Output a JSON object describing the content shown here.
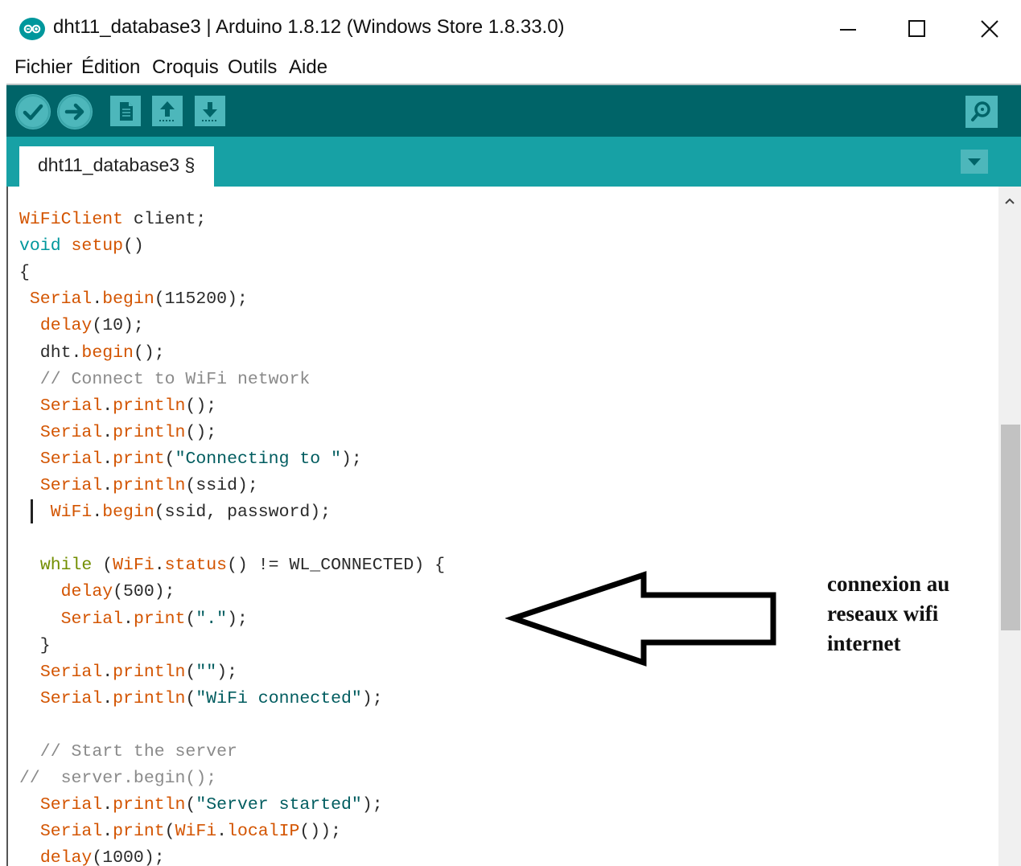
{
  "window": {
    "title": "dht11_database3 | Arduino 1.8.12 (Windows Store 1.8.33.0)",
    "icon": "arduino-infinity-icon",
    "controls": [
      "minimize-icon",
      "maximize-icon",
      "close-icon"
    ]
  },
  "menu": {
    "items": [
      "Fichier",
      "Édition",
      "Croquis",
      "Outils",
      "Aide"
    ]
  },
  "toolbar": {
    "buttons": [
      "verify-icon",
      "upload-icon",
      "new-icon",
      "open-icon",
      "save-icon"
    ],
    "serial_monitor": "serial-monitor-icon",
    "colors": {
      "bar": "#006468",
      "button": "#4db7bb",
      "tabbar": "#17a1a5"
    }
  },
  "tabs": {
    "active": "dht11_database3 §",
    "menu_icon": "tab-dropdown-icon"
  },
  "code": {
    "lines": [
      [
        {
          "t": "WiFiClient",
          "c": "cls"
        },
        {
          "t": " client;",
          "c": "n"
        }
      ],
      [
        {
          "t": "void",
          "c": "type"
        },
        {
          "t": " ",
          "c": "n"
        },
        {
          "t": "setup",
          "c": "fn"
        },
        {
          "t": "()",
          "c": "n"
        }
      ],
      [
        {
          "t": "{",
          "c": "n"
        }
      ],
      [
        {
          "t": " ",
          "c": "n"
        },
        {
          "t": "Serial",
          "c": "cls"
        },
        {
          "t": ".",
          "c": "n"
        },
        {
          "t": "begin",
          "c": "fn"
        },
        {
          "t": "(115200);",
          "c": "n"
        }
      ],
      [
        {
          "t": "  ",
          "c": "n"
        },
        {
          "t": "delay",
          "c": "fn"
        },
        {
          "t": "(10);",
          "c": "n"
        }
      ],
      [
        {
          "t": "  dht.",
          "c": "n"
        },
        {
          "t": "begin",
          "c": "fn"
        },
        {
          "t": "();",
          "c": "n"
        }
      ],
      [
        {
          "t": "  // Connect to WiFi network",
          "c": "cmt"
        }
      ],
      [
        {
          "t": "  ",
          "c": "n"
        },
        {
          "t": "Serial",
          "c": "cls"
        },
        {
          "t": ".",
          "c": "n"
        },
        {
          "t": "println",
          "c": "fn"
        },
        {
          "t": "();",
          "c": "n"
        }
      ],
      [
        {
          "t": "  ",
          "c": "n"
        },
        {
          "t": "Serial",
          "c": "cls"
        },
        {
          "t": ".",
          "c": "n"
        },
        {
          "t": "println",
          "c": "fn"
        },
        {
          "t": "();",
          "c": "n"
        }
      ],
      [
        {
          "t": "  ",
          "c": "n"
        },
        {
          "t": "Serial",
          "c": "cls"
        },
        {
          "t": ".",
          "c": "n"
        },
        {
          "t": "print",
          "c": "fn"
        },
        {
          "t": "(",
          "c": "n"
        },
        {
          "t": "\"Connecting to \"",
          "c": "str"
        },
        {
          "t": ");",
          "c": "n"
        }
      ],
      [
        {
          "t": "  ",
          "c": "n"
        },
        {
          "t": "Serial",
          "c": "cls"
        },
        {
          "t": ".",
          "c": "n"
        },
        {
          "t": "println",
          "c": "fn"
        },
        {
          "t": "(ssid);",
          "c": "n"
        }
      ],
      [
        {
          "t": "   ",
          "c": "n"
        },
        {
          "t": "WiFi",
          "c": "cls"
        },
        {
          "t": ".",
          "c": "n"
        },
        {
          "t": "begin",
          "c": "fn"
        },
        {
          "t": "(ssid, password);",
          "c": "n"
        }
      ],
      [
        {
          "t": "",
          "c": "n"
        }
      ],
      [
        {
          "t": "  ",
          "c": "n"
        },
        {
          "t": "while",
          "c": "ctl"
        },
        {
          "t": " (",
          "c": "n"
        },
        {
          "t": "WiFi",
          "c": "cls"
        },
        {
          "t": ".",
          "c": "n"
        },
        {
          "t": "status",
          "c": "fn"
        },
        {
          "t": "() != WL_CONNECTED) {",
          "c": "n"
        }
      ],
      [
        {
          "t": "    ",
          "c": "n"
        },
        {
          "t": "delay",
          "c": "fn"
        },
        {
          "t": "(500);",
          "c": "n"
        }
      ],
      [
        {
          "t": "    ",
          "c": "n"
        },
        {
          "t": "Serial",
          "c": "cls"
        },
        {
          "t": ".",
          "c": "n"
        },
        {
          "t": "print",
          "c": "fn"
        },
        {
          "t": "(",
          "c": "n"
        },
        {
          "t": "\".\"",
          "c": "str"
        },
        {
          "t": ");",
          "c": "n"
        }
      ],
      [
        {
          "t": "  }",
          "c": "n"
        }
      ],
      [
        {
          "t": "  ",
          "c": "n"
        },
        {
          "t": "Serial",
          "c": "cls"
        },
        {
          "t": ".",
          "c": "n"
        },
        {
          "t": "println",
          "c": "fn"
        },
        {
          "t": "(",
          "c": "n"
        },
        {
          "t": "\"\"",
          "c": "str"
        },
        {
          "t": ");",
          "c": "n"
        }
      ],
      [
        {
          "t": "  ",
          "c": "n"
        },
        {
          "t": "Serial",
          "c": "cls"
        },
        {
          "t": ".",
          "c": "n"
        },
        {
          "t": "println",
          "c": "fn"
        },
        {
          "t": "(",
          "c": "n"
        },
        {
          "t": "\"WiFi connected\"",
          "c": "str"
        },
        {
          "t": ");",
          "c": "n"
        }
      ],
      [
        {
          "t": "",
          "c": "n"
        }
      ],
      [
        {
          "t": "  // Start the server",
          "c": "cmt"
        }
      ],
      [
        {
          "t": "//  server.begin();",
          "c": "cmt"
        }
      ],
      [
        {
          "t": "  ",
          "c": "n"
        },
        {
          "t": "Serial",
          "c": "cls"
        },
        {
          "t": ".",
          "c": "n"
        },
        {
          "t": "println",
          "c": "fn"
        },
        {
          "t": "(",
          "c": "n"
        },
        {
          "t": "\"Server started\"",
          "c": "str"
        },
        {
          "t": ");",
          "c": "n"
        }
      ],
      [
        {
          "t": "  ",
          "c": "n"
        },
        {
          "t": "Serial",
          "c": "cls"
        },
        {
          "t": ".",
          "c": "n"
        },
        {
          "t": "print",
          "c": "fn"
        },
        {
          "t": "(",
          "c": "n"
        },
        {
          "t": "WiFi",
          "c": "cls"
        },
        {
          "t": ".",
          "c": "n"
        },
        {
          "t": "localIP",
          "c": "fn"
        },
        {
          "t": "());",
          "c": "n"
        }
      ],
      [
        {
          "t": "  ",
          "c": "n"
        },
        {
          "t": "delay",
          "c": "fn"
        },
        {
          "t": "(1000);",
          "c": "n"
        }
      ]
    ]
  },
  "annotation": {
    "lines": [
      "connexion au",
      "reseaux wifi",
      "internet"
    ],
    "arrow_icon": "left-arrow-icon"
  }
}
